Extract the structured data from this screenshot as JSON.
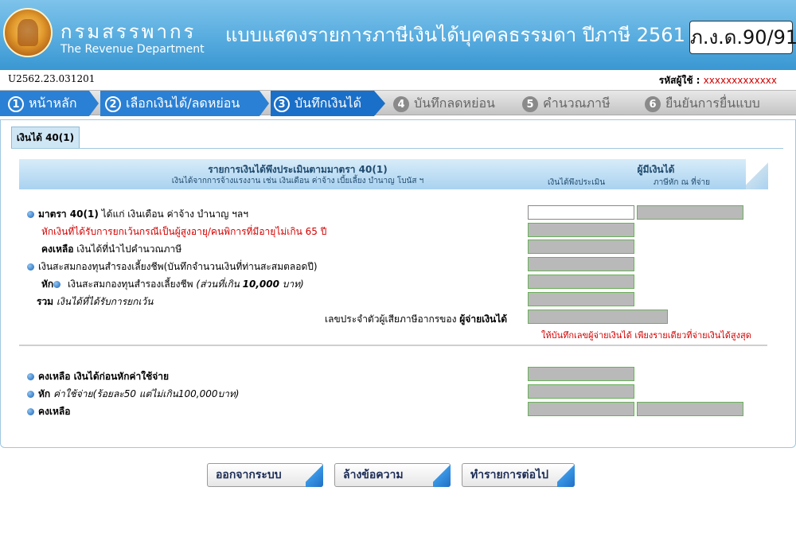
{
  "header": {
    "dept_th": "กรมสรรพากร",
    "dept_en": "The Revenue Department",
    "form_title": "แบบแสดงรายการภาษีเงินได้บุคคลธรรมดา ปีภาษี 2561",
    "form_code": "ภ.ง.ด.90/91"
  },
  "subheader": {
    "ref_code": "U2562.23.031201",
    "taxid_label": "รหัสผู้ใช้ :",
    "taxid_value": "xxxxxxxxxxxxx"
  },
  "steps": [
    {
      "num": "1",
      "label": "หน้าหลัก",
      "state": "done"
    },
    {
      "num": "2",
      "label": "เลือกเงินได้/ลดหย่อน",
      "state": "done"
    },
    {
      "num": "3",
      "label": "บันทึกเงินได้",
      "state": "active"
    },
    {
      "num": "4",
      "label": "บันทึกลดหย่อน",
      "state": "todo"
    },
    {
      "num": "5",
      "label": "คำนวณภาษี",
      "state": "todo"
    },
    {
      "num": "6",
      "label": "ยืนยันการยื่นแบบ",
      "state": "todo"
    }
  ],
  "tab": {
    "label": "เงินได้ 40(1)"
  },
  "table_head": {
    "main": "รายการเงินได้พึงประเมินตามมาตรา 40(1)",
    "sub": "เงินได้จากการจ้างแรงงาน เช่น เงินเดือน ค่าจ้าง เบี้ยเลี้ยง บำนาญ โบนัส ฯ",
    "right": "ผู้มีเงินได้",
    "col1": "เงินได้พึงประเมิน",
    "col2": "ภาษีหัก ณ ที่จ่าย"
  },
  "rows": {
    "r1_bold": "มาตรา 40(1)",
    "r1_text": " ได้แก่ เงินเดือน ค่าจ้าง บำนาญ ฯลฯ",
    "r2_text": "หักเงินที่ได้รับการยกเว้นกรณีเป็นผู้สูงอายุ/คนพิการที่มีอายุไม่เกิน 65 ปี",
    "r3_bold": "คงเหลือ",
    "r3_text": " เงินได้ที่นำไปคำนวณภาษี",
    "r4_text": "เงินสะสมกองทุนสำรองเลี้ยงชีพ(บันทึกจำนวนเงินที่ท่านสะสมตลอดปี)",
    "r5_bold": "หัก",
    "r5_text": " เงินสะสมกองทุนสำรองเลี้ยงชีพ ",
    "r5_italic": "(ส่วนที่เกิน ",
    "r5_italic_bold": "10,000",
    "r5_italic2": " บาท)",
    "r6_bold": "รวม",
    "r6_italic": " เงินได้ที่ได้รับการยกเว้น",
    "r7_text": "เลขประจำตัวผู้เสียภาษีอากรของ ",
    "r7_bold": "ผู้จ่ายเงินได้",
    "note": "ให้บันทึกเลขผู้จ่ายเงินได้ เพียงรายเดียวที่จ่ายเงินได้สูงสุด",
    "r8_bold": "คงเหลือ  เงินได้ก่อนหักค่าใช้จ่าย",
    "r9_bold": "หัก",
    "r9_italic": " ค่าใช้จ่าย(ร้อยละ50 แต่ไม่เกิน100,000บาท)",
    "r10_bold": "คงเหลือ"
  },
  "buttons": {
    "logout": "ออกจากระบบ",
    "clear": "ล้างข้อความ",
    "next": "ทำรายการต่อไป"
  },
  "colors": {
    "header_blue": "#3a97d2",
    "active_step": "#1a6fc8",
    "warning_red": "#d40000",
    "field_gray": "#b9b9b9",
    "field_border_green": "#6ab05a"
  }
}
